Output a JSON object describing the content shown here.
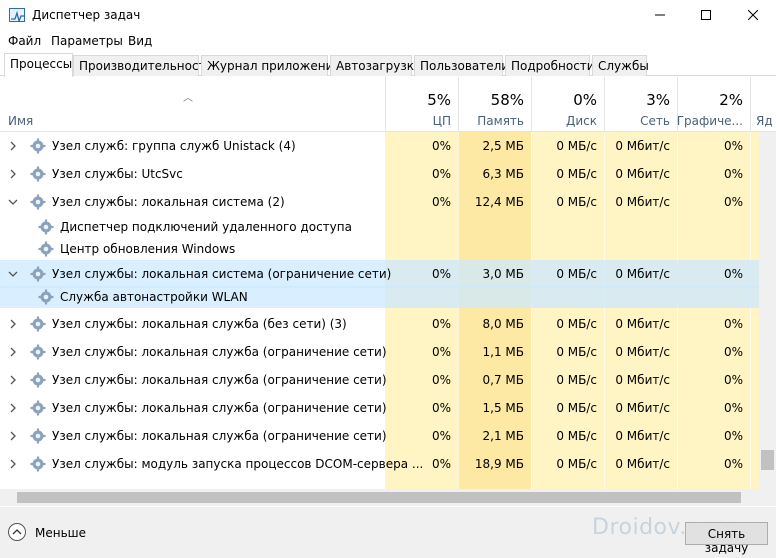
{
  "window": {
    "title": "Диспетчер задач",
    "minimize_icon": "minimize-icon",
    "maximize_icon": "maximize-icon",
    "close_icon": "close-icon"
  },
  "menu": {
    "file": "Файл",
    "options": "Параметры",
    "view": "Вид"
  },
  "tabs": [
    "Процессы",
    "Производительность",
    "Журнал приложений",
    "Автозагрузка",
    "Пользователи",
    "Подробности",
    "Службы"
  ],
  "columns": {
    "name": "Имя",
    "cpu": {
      "pct": "5%",
      "label": "ЦП"
    },
    "mem": {
      "pct": "58%",
      "label": "Память"
    },
    "disk": {
      "pct": "0%",
      "label": "Диск"
    },
    "net": {
      "pct": "3%",
      "label": "Сеть"
    },
    "gpu": {
      "pct": "2%",
      "label": "Графиче..."
    },
    "gpu_engine": {
      "label": "Яд"
    }
  },
  "rows": [
    {
      "name": "Узел служб: группа служб Unistack (4)",
      "cpu": "0%",
      "mem": "2,5 МБ",
      "disk": "0 МБ/с",
      "net": "0 Мбит/с",
      "gpu": "0%"
    },
    {
      "name": "Узел службы: UtcSvc",
      "cpu": "0%",
      "mem": "6,3 МБ",
      "disk": "0 МБ/с",
      "net": "0 Мбит/с",
      "gpu": "0%"
    },
    {
      "name": "Узел службы: локальная система (2)",
      "cpu": "0%",
      "mem": "12,4 МБ",
      "disk": "0 МБ/с",
      "net": "0 Мбит/с",
      "gpu": "0%"
    },
    {
      "name": "Диспетчер подключений удаленного доступа"
    },
    {
      "name": "Центр обновления Windows"
    },
    {
      "name": "Узел службы: локальная система (ограничение сети)",
      "cpu": "0%",
      "mem": "3,0 МБ",
      "disk": "0 МБ/с",
      "net": "0 Мбит/с",
      "gpu": "0%"
    },
    {
      "name": "Служба автонастройки WLAN"
    },
    {
      "name": "Узел службы: локальная служба (без сети) (3)",
      "cpu": "0%",
      "mem": "8,0 МБ",
      "disk": "0 МБ/с",
      "net": "0 Мбит/с",
      "gpu": "0%"
    },
    {
      "name": "Узел службы: локальная служба (ограничение сети)",
      "cpu": "0%",
      "mem": "1,1 МБ",
      "disk": "0 МБ/с",
      "net": "0 Мбит/с",
      "gpu": "0%"
    },
    {
      "name": "Узел службы: локальная служба (ограничение сети)",
      "cpu": "0%",
      "mem": "0,7 МБ",
      "disk": "0 МБ/с",
      "net": "0 Мбит/с",
      "gpu": "0%"
    },
    {
      "name": "Узел службы: локальная служба (ограничение сети)",
      "cpu": "0%",
      "mem": "1,5 МБ",
      "disk": "0 МБ/с",
      "net": "0 Мбит/с",
      "gpu": "0%"
    },
    {
      "name": "Узел службы: локальная служба (ограничение сети)",
      "cpu": "0%",
      "mem": "2,1 МБ",
      "disk": "0 МБ/с",
      "net": "0 Мбит/с",
      "gpu": "0%"
    },
    {
      "name": "Узел службы: модуль запуска процессов DCOM-сервера ...",
      "cpu": "0%",
      "mem": "18,9 МБ",
      "disk": "0 МБ/с",
      "net": "0 Мбит/с",
      "gpu": "0%"
    }
  ],
  "footer": {
    "fewer_details": "Меньше",
    "end_task": "Снять задачу",
    "watermark": "Droidov.com"
  },
  "colors": {
    "cpu_bg": "#fff4c4",
    "mem_bg": "#fde9a4",
    "selected": "#cce8ff",
    "header_label": "#4c607a"
  }
}
